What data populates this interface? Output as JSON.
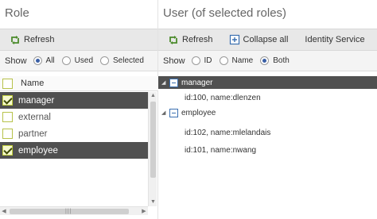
{
  "left": {
    "title": "Role",
    "toolbar": {
      "refresh_label": "Refresh"
    },
    "filter": {
      "show_label": "Show",
      "options": [
        {
          "label": "All",
          "checked": true
        },
        {
          "label": "Used",
          "checked": false
        },
        {
          "label": "Selected",
          "checked": false
        }
      ]
    },
    "grid": {
      "column": "Name",
      "rows": [
        {
          "name": "manager",
          "checked": true,
          "selected": true
        },
        {
          "name": "external",
          "checked": false,
          "selected": false
        },
        {
          "name": "partner",
          "checked": false,
          "selected": false
        },
        {
          "name": "employee",
          "checked": true,
          "selected": true
        }
      ]
    }
  },
  "right": {
    "title": "User (of selected roles)",
    "toolbar": {
      "refresh_label": "Refresh",
      "collapse_label": "Collapse all",
      "identity_label": "Identity Service"
    },
    "filter": {
      "show_label": "Show",
      "options": [
        {
          "label": "ID",
          "checked": false
        },
        {
          "label": "Name",
          "checked": false
        },
        {
          "label": "Both",
          "checked": true
        }
      ]
    },
    "tree": [
      {
        "group": "manager",
        "selected": true,
        "users": [
          "id:100, name:dlenzen"
        ]
      },
      {
        "group": "employee",
        "selected": false,
        "users": [
          "id:102, name:mlelandais",
          "id:101, name:nwang"
        ]
      }
    ]
  },
  "colors": {
    "selected_row": "#505050",
    "toolbar_bg": "#e8e8e8",
    "checkbox_border": "#b7c24a",
    "radio_dot": "#3a5fa6",
    "node_icon": "#3a6fb0"
  },
  "icons": {
    "refresh": "refresh-icon",
    "collapse": "collapse-all-icon",
    "expand_open": "triangle-down-icon",
    "group_node": "group-node-icon"
  }
}
